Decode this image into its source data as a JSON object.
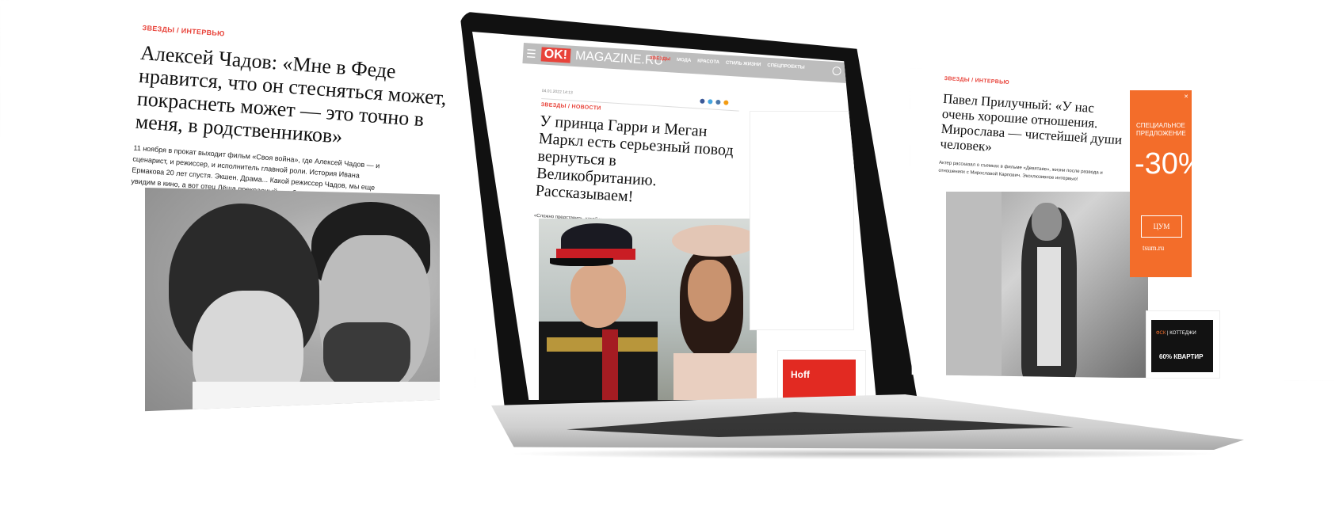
{
  "left_article": {
    "rubric": "ЗВЕЗДЫ / ИНТЕРВЬЮ",
    "title": "Алексей Чадов: «Мне в Феде нравится, что он стесняться может, покраснеть может — это точно в меня, в родственников»",
    "lead": "11 ноября в прокат выходит фильм «Своя война», где Алексей Чадов — и сценарист, и режиссер, и исполнитель главной роли. История Ивана Ермакова 20 лет спустя. Экшен. Драма... Какой режиссер Чадов, мы еще увидим в кино, а вот отец Лёша прекрасный — убедились на съемке."
  },
  "laptop_site": {
    "logo_ok": "OK!",
    "logo_rest": "MAGAZINE.RU",
    "nav_items": [
      "ЗВЕЗДЫ",
      "МОДА",
      "КРАСОТА",
      "СТИЛЬ ЖИЗНИ",
      "СПЕЦПРОЕКТЫ"
    ],
    "article": {
      "date": "04.01.2022 14:13",
      "rubric": "ЗВЕЗДЫ / НОВОСТИ",
      "title": "У принца Гарри и Меган Маркл есть серьезный повод вернуться в Великобританию. Рассказываем!",
      "lead": "«Сложно представить, какой шум они могут поднять»."
    },
    "ad_label": "Hoff"
  },
  "right_article": {
    "rubric": "ЗВЕЗДЫ / ИНТЕРВЬЮ",
    "title": "Павел Прилучный: «У нас очень хорошие отношения. Мирослава — чистейшей души человек»",
    "lead": "Актер рассказал о съемках в фильме «Девятаев», жизни после развода и отношениях с Мирославой Карпович. Эксклюзивное интервью!",
    "promo": {
      "line": "СПЕЦИАЛЬНОЕ ПРЕДЛОЖЕНИЕ",
      "discount": "-30%",
      "logo": "ЦУМ",
      "site": "tsum.ru"
    },
    "fsk": {
      "brand": "ФСК",
      "partner": "КОТТЕДЖИ",
      "offer": "60% КВАРТИР"
    }
  },
  "colors": {
    "accent": "#e8433a",
    "promo_orange": "#f36d2a"
  }
}
